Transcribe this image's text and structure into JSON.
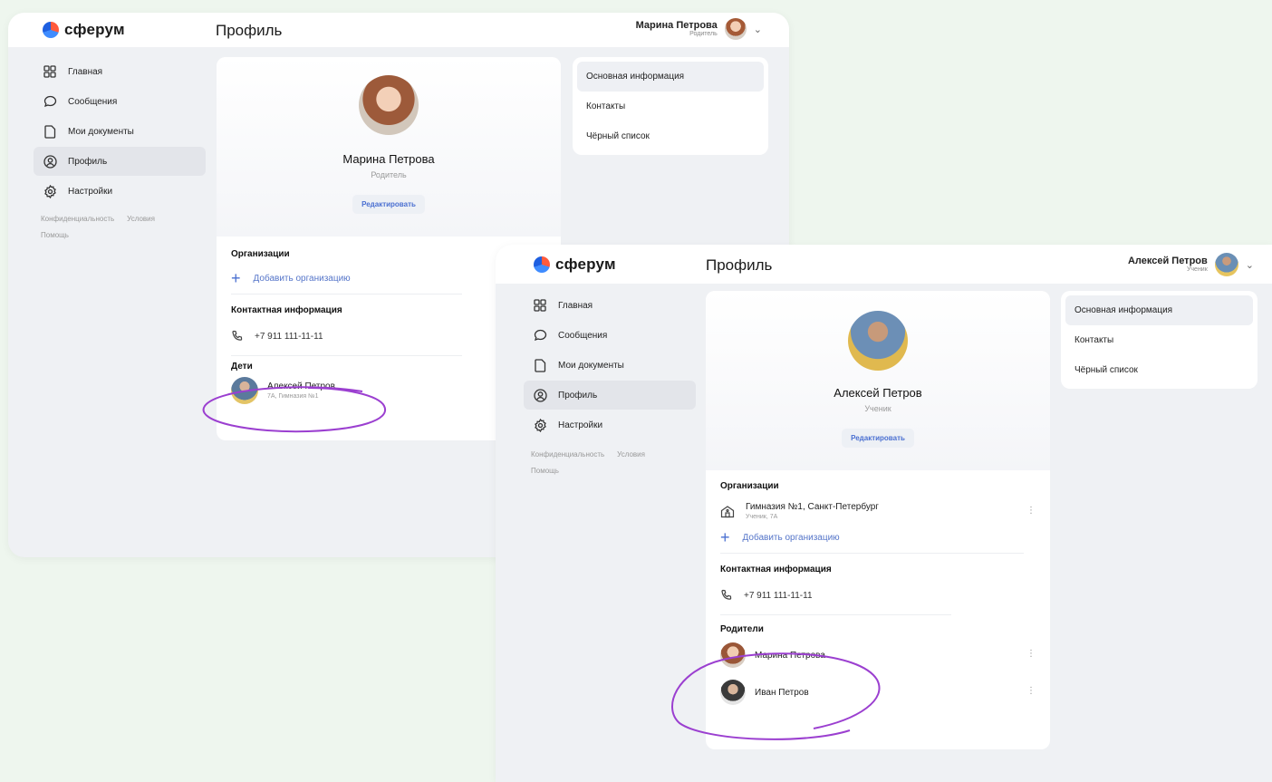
{
  "app": {
    "logo_text": "сферум",
    "accent": "#4a6fd1",
    "annotation_color": "#9b3fd0"
  },
  "nav": [
    {
      "label": "Главная",
      "icon": "grid-icon"
    },
    {
      "label": "Сообщения",
      "icon": "chat-icon"
    },
    {
      "label": "Мои документы",
      "icon": "document-icon"
    },
    {
      "label": "Профиль",
      "icon": "profile-icon"
    },
    {
      "label": "Настройки",
      "icon": "settings-icon"
    }
  ],
  "footer": {
    "privacy": "Конфиденциальность",
    "terms": "Условия",
    "help": "Помощь"
  },
  "side_menu": [
    "Основная информация",
    "Контакты",
    "Чёрный список"
  ],
  "parent_window": {
    "page_title": "Профиль",
    "user": {
      "name": "Марина Петрова",
      "role": "Родитель"
    },
    "profile": {
      "name": "Марина Петрова",
      "role": "Родитель",
      "edit_label": "Редактировать"
    },
    "orgs_title": "Организации",
    "add_org": "Добавить организацию",
    "contacts_title": "Контактная информация",
    "phone": "+7 911 111-11-11",
    "children_title": "Дети",
    "child": {
      "name": "Алексей Петров",
      "info": "7А, Гимназия №1"
    }
  },
  "student_window": {
    "page_title": "Профиль",
    "user": {
      "name": "Алексей Петров",
      "role": "Ученик"
    },
    "profile": {
      "name": "Алексей Петров",
      "role": "Ученик",
      "edit_label": "Редактировать"
    },
    "orgs_title": "Организации",
    "org": {
      "name": "Гимназия №1, Санкт-Петербург",
      "info": "Ученик, 7А"
    },
    "add_org": "Добавить организацию",
    "contacts_title": "Контактная информация",
    "phone": "+7 911 111-11-11",
    "parents_title": "Родители",
    "parents": [
      {
        "name": "Марина Петрова"
      },
      {
        "name": "Иван Петров"
      }
    ]
  }
}
